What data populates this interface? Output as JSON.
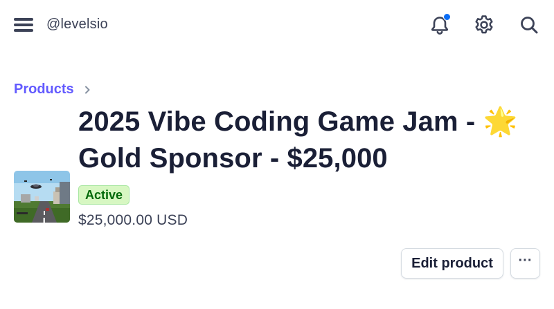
{
  "header": {
    "username": "@levelsio",
    "icons": [
      "menu-icon",
      "bell-icon",
      "gear-icon",
      "search-icon"
    ],
    "has_notification": true
  },
  "breadcrumb": {
    "label": "Products"
  },
  "product": {
    "title": "2025 Vibe Coding Game Jam - 🌟 Gold Sponsor - $25,000",
    "status": "Active",
    "price": "$25,000.00 USD",
    "thumbnail_icon": "game-screenshot-thumbnail"
  },
  "actions": {
    "edit_label": "Edit product",
    "more_label": "···"
  },
  "colors": {
    "accent": "#635bff",
    "notification": "#0a6cf5",
    "status_bg": "#d7f7c2",
    "status_text": "#006908"
  }
}
